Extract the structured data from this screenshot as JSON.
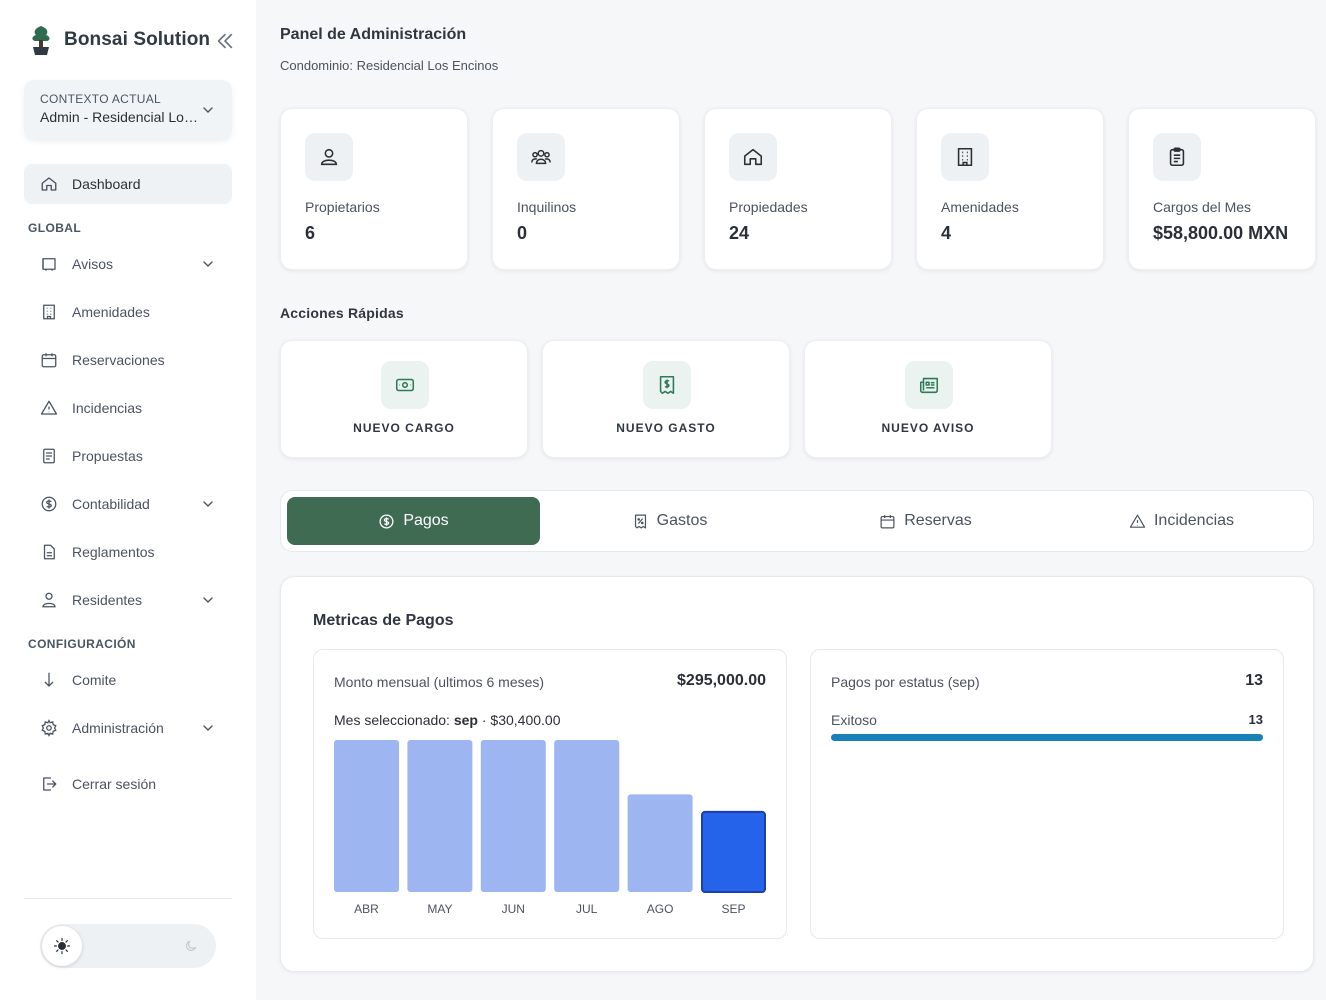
{
  "app": {
    "name": "Bonsai Solution"
  },
  "context": {
    "label": "CONTEXTO ACTUAL",
    "value": "Admin - Residencial Los Encinos"
  },
  "nav": {
    "dashboard": "Dashboard",
    "global_label": "GLOBAL",
    "avisos": "Avisos",
    "amenidades": "Amenidades",
    "reservaciones": "Reservaciones",
    "incidencias": "Incidencias",
    "propuestas": "Propuestas",
    "contabilidad": "Contabilidad",
    "reglamentos": "Reglamentos",
    "residentes": "Residentes",
    "config_label": "CONFIGURACIÓN",
    "comite": "Comite",
    "administracion": "Administración",
    "logout": "Cerrar sesión"
  },
  "header": {
    "title": "Panel de Administración",
    "subtitle": "Condominio: Residencial Los Encinos"
  },
  "stats": [
    {
      "label": "Propietarios",
      "value": "6",
      "icon": "user-icon"
    },
    {
      "label": "Inquilinos",
      "value": "0",
      "icon": "users-icon"
    },
    {
      "label": "Propiedades",
      "value": "24",
      "icon": "home-icon"
    },
    {
      "label": "Amenidades",
      "value": "4",
      "icon": "building-icon"
    },
    {
      "label": "Cargos del Mes",
      "value": "$58,800.00 MXN",
      "icon": "clipboard-icon"
    }
  ],
  "quick_actions": {
    "title": "Acciones Rápidas",
    "items": [
      {
        "label": "NUEVO CARGO",
        "icon": "cash-icon"
      },
      {
        "label": "NUEVO GASTO",
        "icon": "receipt-icon"
      },
      {
        "label": "NUEVO AVISO",
        "icon": "newspaper-icon"
      }
    ]
  },
  "tabs": [
    {
      "label": "Pagos",
      "icon": "dollar-circle-icon",
      "active": true
    },
    {
      "label": "Gastos",
      "icon": "receipt-percent-icon",
      "active": false
    },
    {
      "label": "Reservas",
      "icon": "calendar-icon",
      "active": false
    },
    {
      "label": "Incidencias",
      "icon": "warning-icon",
      "active": false
    }
  ],
  "metrics": {
    "title": "Metricas de Pagos",
    "monthly": {
      "title": "Monto mensual (ultimos 6 meses)",
      "total": "$295,000.00",
      "selected_prefix": "Mes seleccionado:",
      "selected_month": "sep",
      "selected_amount": "· $30,400.00"
    },
    "status": {
      "title": "Pagos por estatus (sep)",
      "total": "13",
      "items": [
        {
          "label": "Exitoso",
          "count": "13",
          "fraction": 1.0
        }
      ]
    }
  },
  "colors": {
    "accent": "#3f6b52",
    "bar": "#9db6f2",
    "bar_selected": "#2563eb",
    "progress": "#1781b8"
  },
  "chart_data": {
    "type": "bar",
    "categories": [
      "ABR",
      "MAY",
      "JUN",
      "JUL",
      "AGO",
      "SEP"
    ],
    "values": [
      57000,
      57000,
      57000,
      57000,
      36600,
      30400
    ],
    "highlighted": "SEP",
    "ylim": [
      0,
      57000
    ],
    "grid": false
  }
}
